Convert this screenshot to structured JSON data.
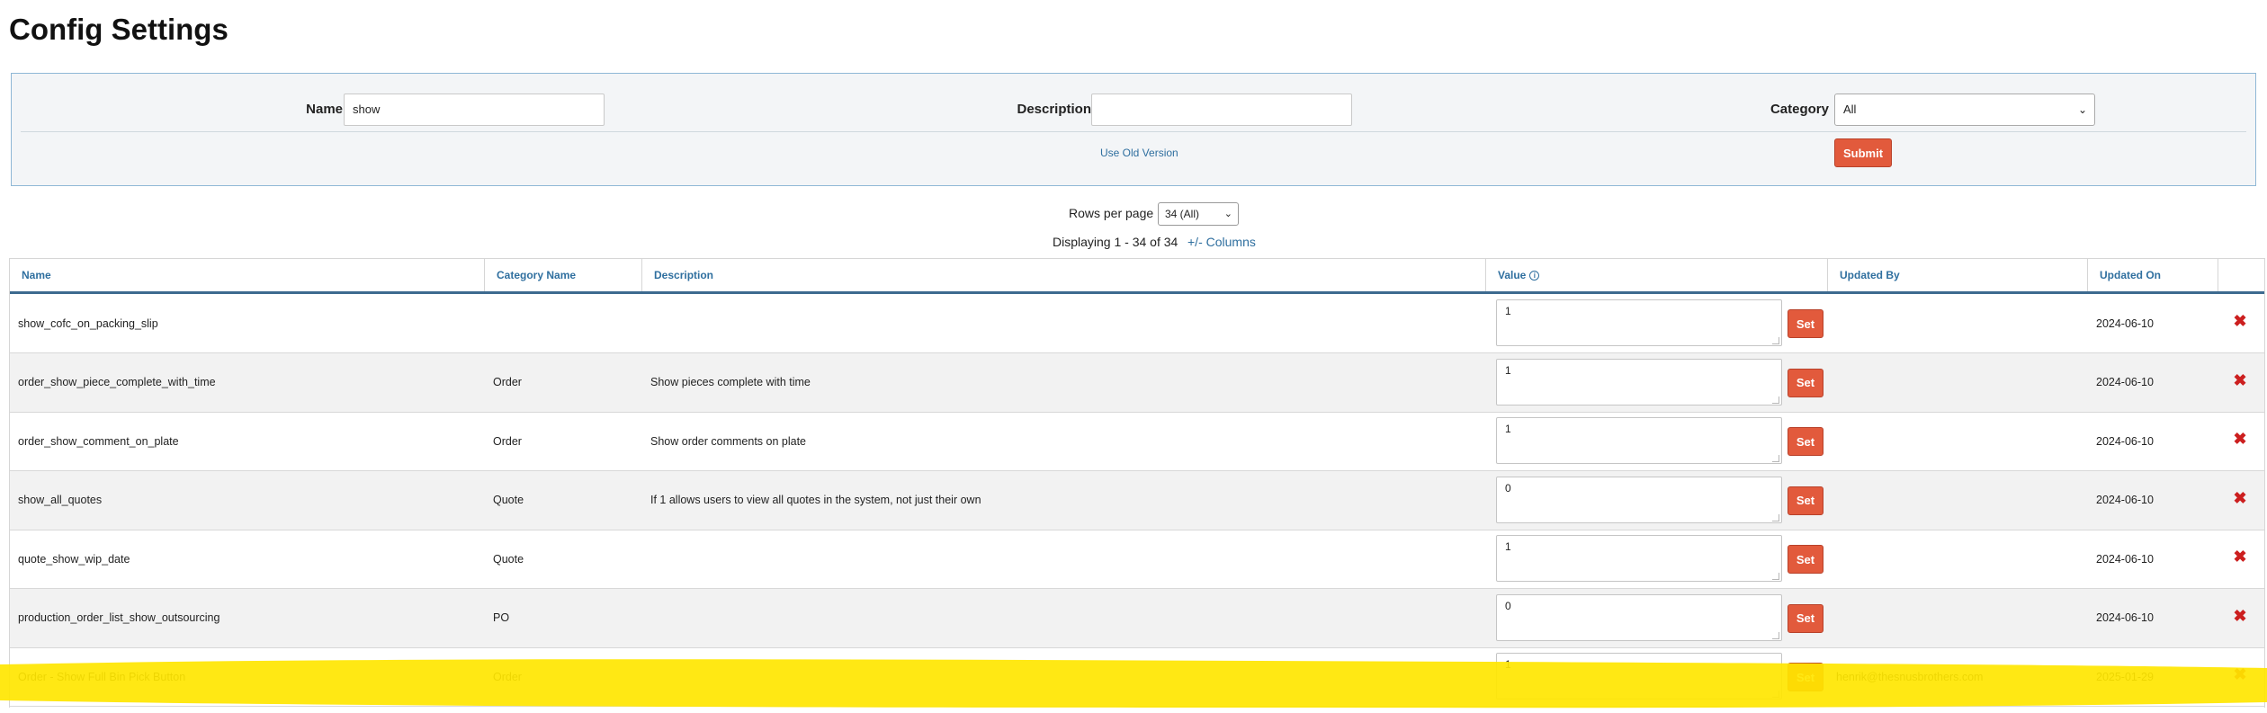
{
  "page": {
    "title": "Config Settings"
  },
  "filters": {
    "name_label": "Name",
    "name_value": "show",
    "description_label": "Description",
    "description_value": "",
    "category_label": "Category",
    "category_selected": "All",
    "old_version_link": "Use Old Version",
    "submit_label": "Submit"
  },
  "pagination": {
    "rows_label": "Rows per page",
    "rows_selected": "34 (All)",
    "display_text": "Displaying 1 - 34 of 34",
    "columns_link": "+/-  Columns"
  },
  "table": {
    "headers": {
      "name": "Name",
      "category": "Category Name",
      "description": "Description",
      "value": "Value",
      "updated_by": "Updated By",
      "updated_on": "Updated On"
    },
    "set_label": "Set",
    "rows": [
      {
        "name": "show_cofc_on_packing_slip",
        "category": "",
        "description": "",
        "value": "1",
        "updated_by": "",
        "updated_on": "2024-06-10"
      },
      {
        "name": "order_show_piece_complete_with_time",
        "category": "Order",
        "description": "Show pieces complete with time",
        "value": "1",
        "updated_by": "",
        "updated_on": "2024-06-10"
      },
      {
        "name": "order_show_comment_on_plate",
        "category": "Order",
        "description": "Show order comments on plate",
        "value": "1",
        "updated_by": "",
        "updated_on": "2024-06-10"
      },
      {
        "name": "show_all_quotes",
        "category": "Quote",
        "description": "If 1 allows users to view all quotes in the system, not just their own",
        "value": "0",
        "updated_by": "",
        "updated_on": "2024-06-10"
      },
      {
        "name": "quote_show_wip_date",
        "category": "Quote",
        "description": "",
        "value": "1",
        "updated_by": "",
        "updated_on": "2024-06-10"
      },
      {
        "name": "production_order_list_show_outsourcing",
        "category": "PO",
        "description": "",
        "value": "0",
        "updated_by": "",
        "updated_on": "2024-06-10"
      },
      {
        "name": "Order - Show Full Bin Pick Button",
        "category": "Order",
        "description": "",
        "value": "1",
        "updated_by": "henrik@thesnusbrothers.com",
        "updated_on": "2025-01-29"
      }
    ]
  },
  "colors": {
    "accent_button": "#e25a3c",
    "link": "#2f6f9f",
    "delete": "#cc1f1f",
    "highlight": "#ffe600"
  },
  "icons": {
    "delete": "close-x-icon",
    "info": "info-icon",
    "chevron": "chevron-down-icon"
  }
}
